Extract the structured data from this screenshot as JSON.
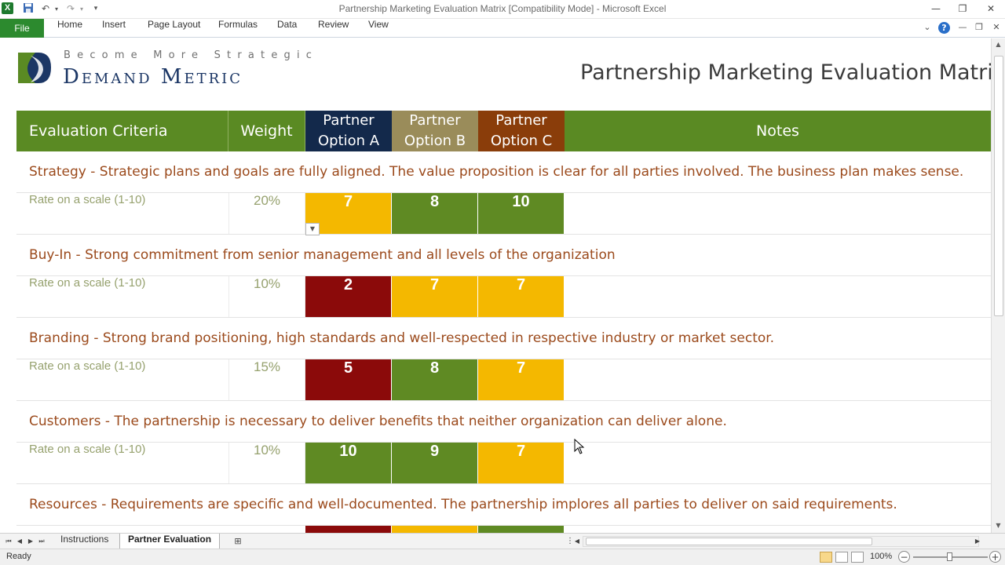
{
  "window": {
    "title": "Partnership Marketing Evaluation Matrix  [Compatibility Mode]  -  Microsoft Excel",
    "app_icon": "excel-icon"
  },
  "ribbon": {
    "file_label": "File",
    "tabs": [
      "Home",
      "Insert",
      "Page Layout",
      "Formulas",
      "Data",
      "Review",
      "View"
    ]
  },
  "header": {
    "tagline": "Become More Strategic",
    "brand": "Demand Metric",
    "doc_title": "Partnership Marketing Evaluation Matrix"
  },
  "table": {
    "col_criteria": "Evaluation Criteria",
    "col_weight": "Weight",
    "options": [
      {
        "line1": "Partner",
        "line2": "Option A",
        "color": "#13294b"
      },
      {
        "line1": "Partner",
        "line2": "Option B",
        "color": "#9a8c5a"
      },
      {
        "line1": "Partner",
        "line2": "Option C",
        "color": "#8a3d0a"
      }
    ],
    "col_notes": "Notes",
    "rate_label": "Rate on a scale (1-10)",
    "rows": [
      {
        "criterion": "Strategy - Strategic plans and goals are fully aligned. The value proposition is clear for all parties involved. The business plan makes sense.",
        "weight": "20%",
        "scores": [
          "7",
          "8",
          "10"
        ]
      },
      {
        "criterion": "Buy-In - Strong commitment from senior management and all levels of the organization",
        "weight": "10%",
        "scores": [
          "2",
          "7",
          "7"
        ]
      },
      {
        "criterion": "Branding - Strong brand positioning, high standards and well-respected in respective industry or market sector.",
        "weight": "15%",
        "scores": [
          "5",
          "8",
          "7"
        ]
      },
      {
        "criterion": "Customers - The partnership is necessary to deliver benefits that neither organization can deliver alone.",
        "weight": "10%",
        "scores": [
          "10",
          "9",
          "7"
        ]
      },
      {
        "criterion": "Resources - Requirements are specific and well-documented.  The partnership implores all parties to deliver on said requirements.",
        "weight": "",
        "scores": []
      }
    ],
    "score_colors": {
      "high": "#5f8a23",
      "mid": "#f4b800",
      "low": "#8b0a0a"
    }
  },
  "sheet_tabs": [
    "Instructions",
    "Partner Evaluation"
  ],
  "active_sheet": "Partner Evaluation",
  "status": {
    "ready": "Ready",
    "zoom": "100%"
  }
}
